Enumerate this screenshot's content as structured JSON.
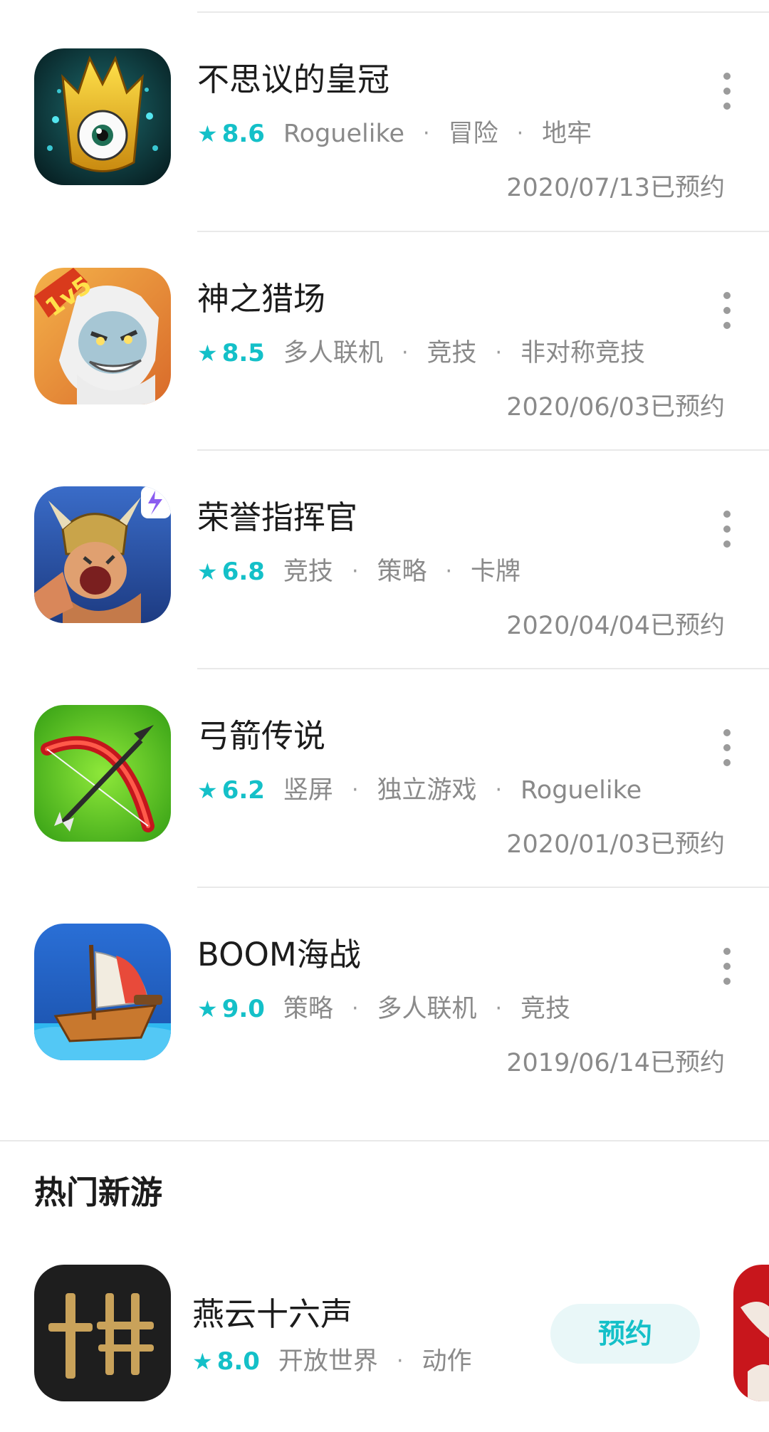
{
  "theme": {
    "accent": "#14c0c8",
    "tag_color": "#8a8a8a",
    "divider": "#e9e9e9"
  },
  "games": [
    {
      "name": "不思议的皇冠",
      "rating": "8.6",
      "tags": [
        "Roguelike",
        "冒险",
        "地牢"
      ],
      "date": "2020/07/13已预约",
      "icon": "crown-cyclops-icon"
    },
    {
      "name": "神之猎场",
      "rating": "8.5",
      "tags": [
        "多人联机",
        "竞技",
        "非对称竞技"
      ],
      "date": "2020/06/03已预约",
      "icon": "zeus-1v5-icon",
      "icon_badge": "1v5"
    },
    {
      "name": "荣誉指挥官",
      "rating": "6.8",
      "tags": [
        "竞技",
        "策略",
        "卡牌"
      ],
      "date": "2020/04/04已预约",
      "icon": "viking-warrior-icon"
    },
    {
      "name": "弓箭传说",
      "rating": "6.2",
      "tags": [
        "竖屏",
        "独立游戏",
        "Roguelike"
      ],
      "date": "2020/01/03已预约",
      "icon": "bow-arrow-icon"
    },
    {
      "name": "BOOM海战",
      "rating": "9.0",
      "tags": [
        "策略",
        "多人联机",
        "竞技"
      ],
      "date": "2019/06/14已预约",
      "icon": "pirate-ship-icon"
    }
  ],
  "hot_section": {
    "title": "热门新游",
    "game": {
      "name": "燕云十六声",
      "rating": "8.0",
      "tags": [
        "开放世界",
        "动作"
      ],
      "button_label": "预约",
      "icon": "yanyun-logo-icon"
    },
    "peek_icon": "red-game-icon"
  },
  "symbols": {
    "star": "★",
    "dot": "·"
  }
}
